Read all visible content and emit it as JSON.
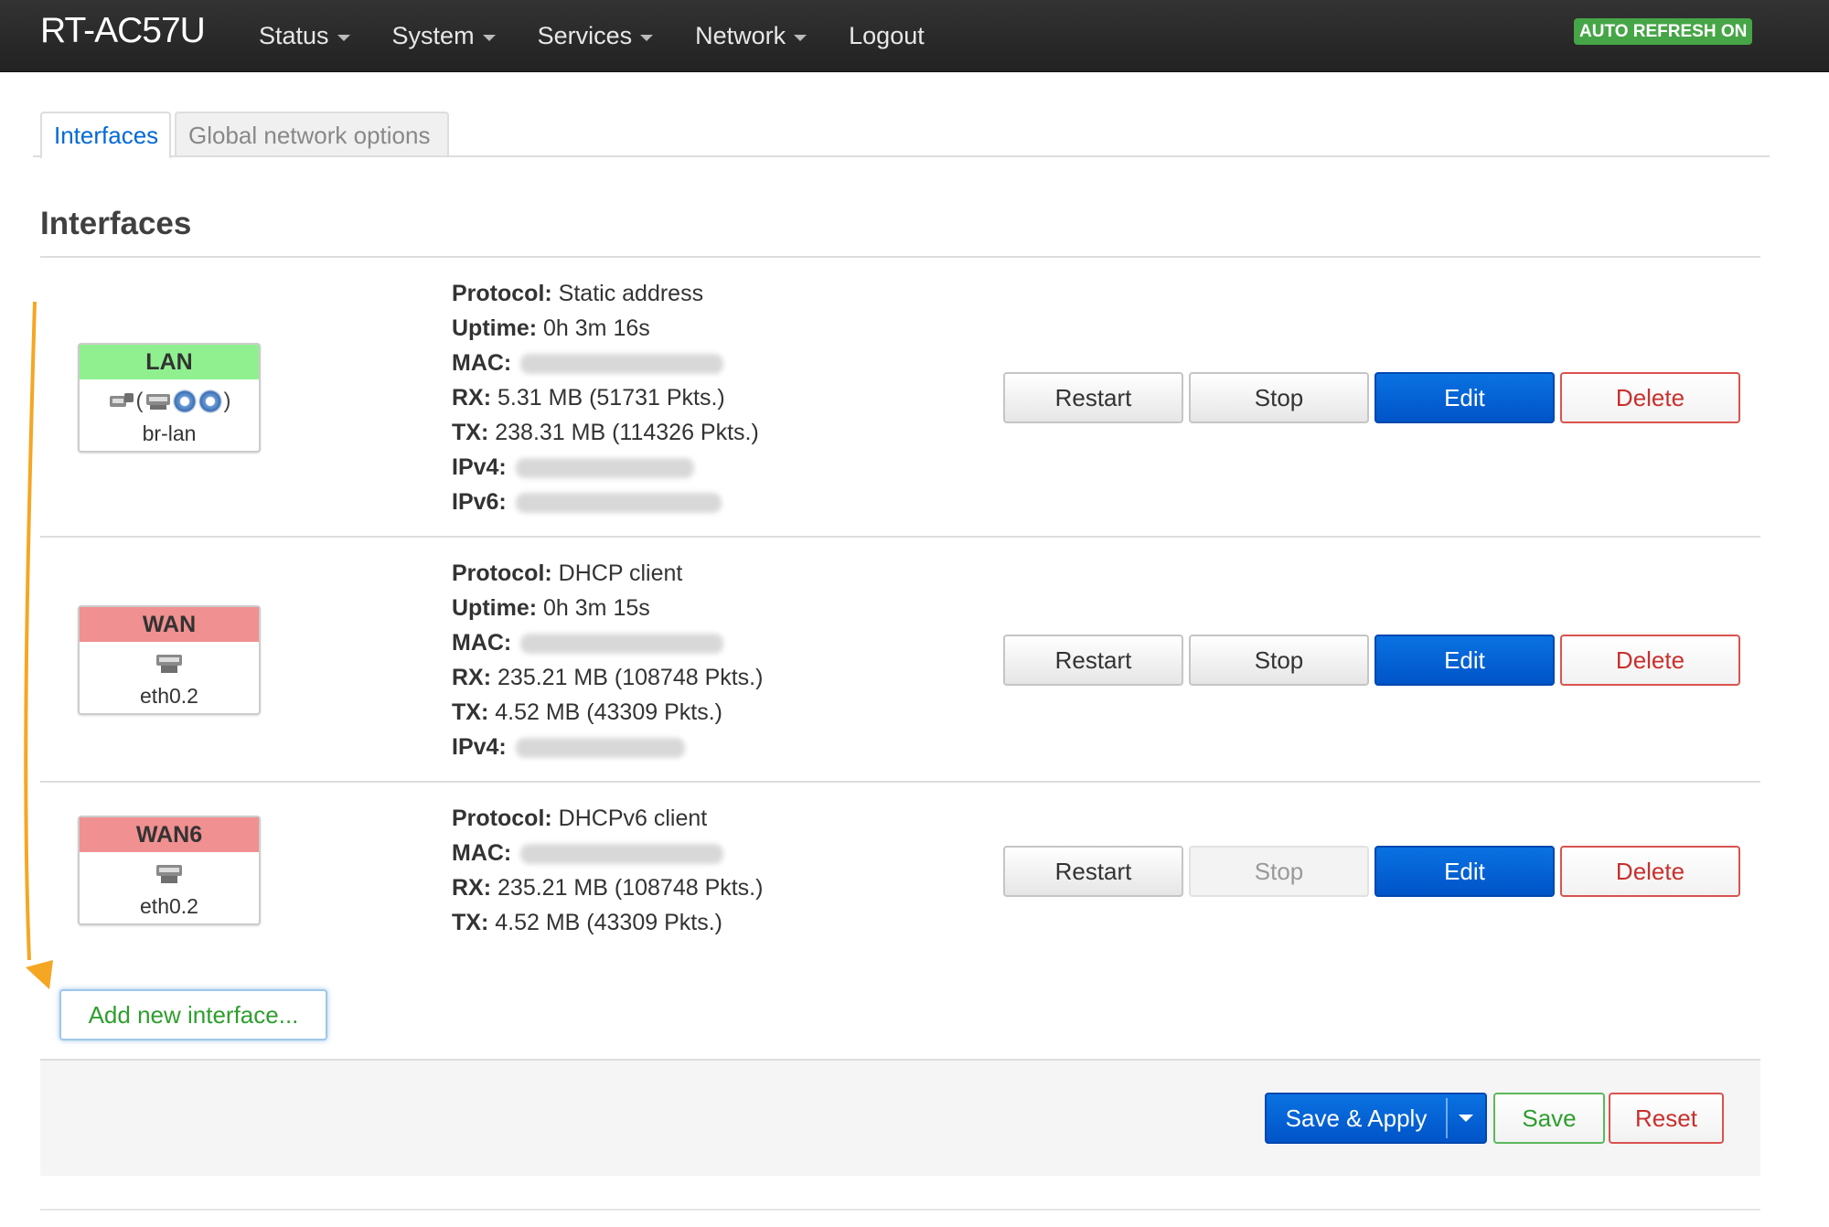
{
  "header": {
    "brand": "RT-AC57U",
    "nav": [
      {
        "label": "Status",
        "dropdown": true
      },
      {
        "label": "System",
        "dropdown": true
      },
      {
        "label": "Services",
        "dropdown": true
      },
      {
        "label": "Network",
        "dropdown": true
      },
      {
        "label": "Logout",
        "dropdown": false
      }
    ],
    "auto_refresh": "AUTO REFRESH ON"
  },
  "tabs": [
    {
      "label": "Interfaces",
      "active": true
    },
    {
      "label": "Global network options",
      "active": false
    }
  ],
  "section_title": "Interfaces",
  "interfaces": [
    {
      "name": "LAN",
      "status_color": "#90f090",
      "device": "br-lan",
      "icons": [
        "ethernet-icon",
        "bridge-open-paren",
        "ethernet-icon",
        "wifi-icon",
        "wifi-icon",
        "bridge-close-paren"
      ],
      "details": [
        {
          "label": "Protocol:",
          "value": "Static address"
        },
        {
          "label": "Uptime:",
          "value": "0h 3m 16s"
        },
        {
          "label": "MAC:",
          "value": ""
        },
        {
          "label": "RX:",
          "value": "5.31 MB (51731 Pkts.)"
        },
        {
          "label": "TX:",
          "value": "238.31 MB (114326 Pkts.)"
        },
        {
          "label": "IPv4:",
          "value": ""
        },
        {
          "label": "IPv6:",
          "value": ""
        }
      ],
      "buttons": {
        "restart": "Restart",
        "stop": "Stop",
        "edit": "Edit",
        "delete": "Delete"
      },
      "stop_disabled": false
    },
    {
      "name": "WAN",
      "status_color": "#f09090",
      "device": "eth0.2",
      "details": [
        {
          "label": "Protocol:",
          "value": "DHCP client"
        },
        {
          "label": "Uptime:",
          "value": "0h 3m 15s"
        },
        {
          "label": "MAC:",
          "value": ""
        },
        {
          "label": "RX:",
          "value": "235.21 MB (108748 Pkts.)"
        },
        {
          "label": "TX:",
          "value": "4.52 MB (43309 Pkts.)"
        },
        {
          "label": "IPv4:",
          "value": ""
        }
      ],
      "buttons": {
        "restart": "Restart",
        "stop": "Stop",
        "edit": "Edit",
        "delete": "Delete"
      },
      "stop_disabled": false
    },
    {
      "name": "WAN6",
      "status_color": "#f09090",
      "device": "eth0.2",
      "details": [
        {
          "label": "Protocol:",
          "value": "DHCPv6 client"
        },
        {
          "label": "MAC:",
          "value": ""
        },
        {
          "label": "RX:",
          "value": "235.21 MB (108748 Pkts.)"
        },
        {
          "label": "TX:",
          "value": "4.52 MB (43309 Pkts.)"
        }
      ],
      "buttons": {
        "restart": "Restart",
        "stop": "Stop",
        "edit": "Edit",
        "delete": "Delete"
      },
      "stop_disabled": true
    }
  ],
  "add_interface": "Add new interface...",
  "footer": {
    "save_apply": "Save & Apply",
    "save": "Save",
    "reset": "Reset"
  },
  "colors": {
    "accent": "#0054c8",
    "annotation_arrow": "#f5a623"
  }
}
